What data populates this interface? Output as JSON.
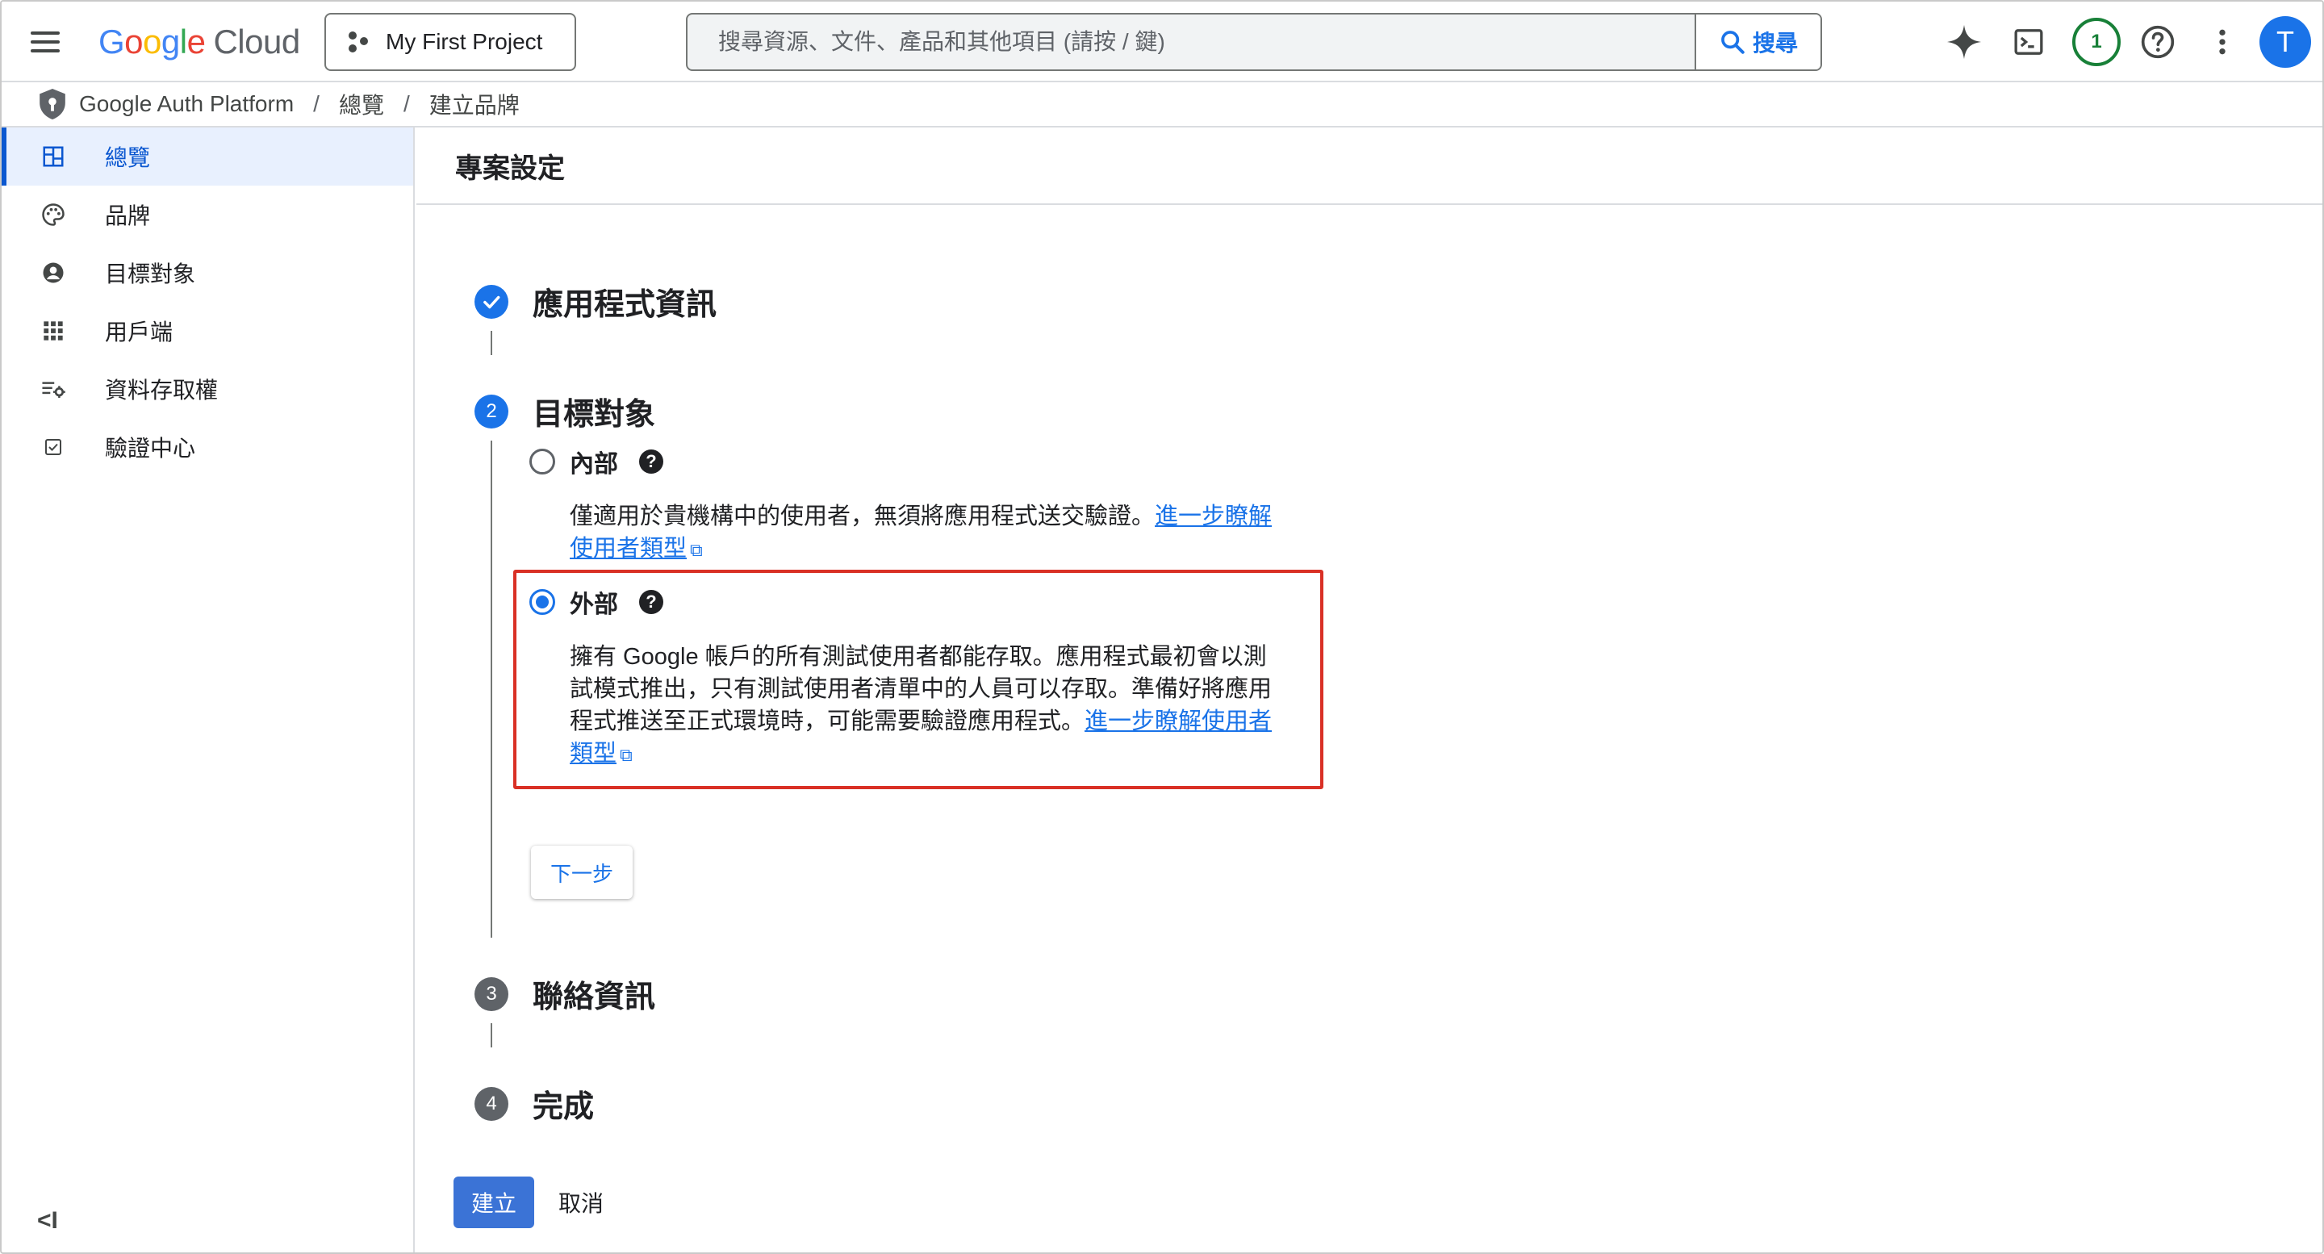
{
  "header": {
    "logo": {
      "g1": "G",
      "g2": "o",
      "g3": "o",
      "g4": "g",
      "g5": "l",
      "g6": "e",
      "cloud": "Cloud"
    },
    "project_label": "My First Project",
    "search_placeholder": "搜尋資源、文件、產品和其他項目 (請按 / 鍵)",
    "search_button": "搜尋",
    "notification_count": "1",
    "avatar_initial": "T",
    "icons": [
      "menu-icon",
      "project-dots-icon",
      "search-icon",
      "gemini-spark-icon",
      "terminal-icon",
      "help-icon",
      "more-vert-icon"
    ]
  },
  "breadcrumb": {
    "items": [
      "Google Auth Platform",
      "總覽",
      "建立品牌"
    ],
    "separator": "/"
  },
  "sidebar": {
    "items": [
      {
        "label": "總覽",
        "icon": "dashboard-icon",
        "active": true
      },
      {
        "label": "品牌",
        "icon": "palette-icon"
      },
      {
        "label": "目標對象",
        "icon": "account-circle-icon"
      },
      {
        "label": "用戶端",
        "icon": "apps-grid-icon"
      },
      {
        "label": "資料存取權",
        "icon": "data-settings-icon"
      },
      {
        "label": "驗證中心",
        "icon": "checkbox-icon"
      }
    ],
    "collapse_label": "<I"
  },
  "main": {
    "title": "專案設定",
    "steps": [
      {
        "number": "1",
        "title": "應用程式資訊",
        "state": "done"
      },
      {
        "number": "2",
        "title": "目標對象",
        "state": "current"
      },
      {
        "number": "3",
        "title": "聯絡資訊",
        "state": "todo"
      },
      {
        "number": "4",
        "title": "完成",
        "state": "todo"
      }
    ],
    "audience": {
      "internal": {
        "label": "內部",
        "desc": "僅適用於貴機構中的使用者，無須將應用程式送交驗證。",
        "link_a": "進一步瞭解",
        "link_b": "使用者類型"
      },
      "external": {
        "label": "外部",
        "selected": true,
        "desc_line1": "擁有 Google 帳戶的所有測試使用者都能存取。應用程式最初會以測",
        "desc_line2": "試模式推出，只有測試使用者清單中的人員可以存取。準備好將應用",
        "desc_line3": "程式推送至正式環境時，可能需要驗證應用程式。",
        "link_a": "進一步瞭解使用者",
        "link_b": "類型"
      },
      "help_glyph": "?"
    },
    "next_button": "下一步",
    "create_button": "建立",
    "cancel_button": "取消"
  },
  "colors": {
    "accent": "#1a73e8",
    "highlight_border": "#d93025",
    "counter_green": "#188038"
  }
}
